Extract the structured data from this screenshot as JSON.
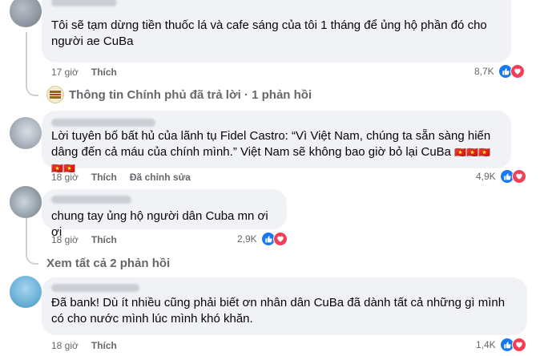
{
  "comments": [
    {
      "text": "Tôi sẽ tạm dừng tiền thuốc lá và cafe sáng của tôi 1 tháng để ủng hộ phần đó cho người ae CuBa",
      "time": "17 giờ",
      "like_label": "Thích",
      "reaction_count": "8,7K"
    },
    {
      "text": "Lời tuyên bố bất hủ của lãnh tụ Fidel Castro: “Vì Việt Nam, chúng ta sẵn sàng hiến dâng đến cả máu của chính mình.” Việt Nam sẽ không bao giờ bỏ lại CuBa",
      "flags": "🇻🇳🇻🇳🇻🇳🇻🇳🇻🇳",
      "time": "18 giờ",
      "like_label": "Thích",
      "edited_label": "Đã chỉnh sửa",
      "reaction_count": "4,9K"
    },
    {
      "text": "chung tay ủng hộ người dân Cuba mn ơi ơi",
      "time": "18 giờ",
      "like_label": "Thích",
      "reaction_count": "2,9K"
    },
    {
      "text": "Đã bank! Dù ít nhiều cũng phải biết ơn nhân dân CuBa đã dành tất cả những gì mình có cho nước mình lúc mình khó khăn.",
      "time": "18 giờ",
      "like_label": "Thích",
      "reaction_count": "1,4K"
    }
  ],
  "reply_summary": {
    "text": "Thông tin Chính phủ đã trả lời · 1 phản hồi"
  },
  "view_more": {
    "text": "Xem tất cả 2 phản hồi"
  },
  "icons": {
    "like": "like-icon",
    "love": "love-icon",
    "avatar_blurred": "avatar"
  },
  "colors": {
    "like": "#1877f2",
    "love": "#f33e58",
    "bubble": "#f0f2f5",
    "meta": "#65676b"
  }
}
